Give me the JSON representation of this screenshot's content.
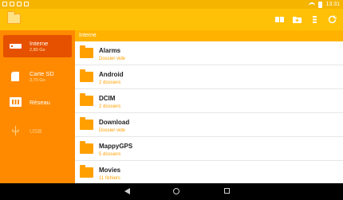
{
  "status_bar": {
    "time": "13:31"
  },
  "app_bar": {
    "icons": [
      "folder-icon",
      "grid-view-icon",
      "new-folder-icon",
      "sort-icon",
      "refresh-icon"
    ]
  },
  "sidebar": {
    "items": [
      {
        "label": "Interne",
        "sub": "2,80 Go",
        "icon": "internal-storage-icon",
        "active": true
      },
      {
        "label": "Carte SD",
        "sub": "3,70 Go",
        "icon": "sd-card-icon",
        "active": false
      },
      {
        "label": "Réseau",
        "sub": "",
        "icon": "network-icon",
        "active": false
      },
      {
        "label": "USB",
        "sub": "",
        "icon": "usb-icon",
        "active": false,
        "disabled": true
      }
    ]
  },
  "path": {
    "current": "Interne"
  },
  "files": [
    {
      "name": "Alarms",
      "meta": "Dossier vide"
    },
    {
      "name": "Android",
      "meta": "2 dossiers"
    },
    {
      "name": "DCIM",
      "meta": "2 dossiers"
    },
    {
      "name": "Download",
      "meta": "Dossier vide"
    },
    {
      "name": "MappyGPS",
      "meta": "5 dossiers"
    },
    {
      "name": "Movies",
      "meta": "11 fichiers"
    }
  ],
  "colors": {
    "status_bar": "#f5b400",
    "app_bar": "#ffc107",
    "sidebar": "#ff8a00",
    "sidebar_active": "#e65100",
    "path_bar": "#ffb300",
    "folder": "#ffa000"
  }
}
